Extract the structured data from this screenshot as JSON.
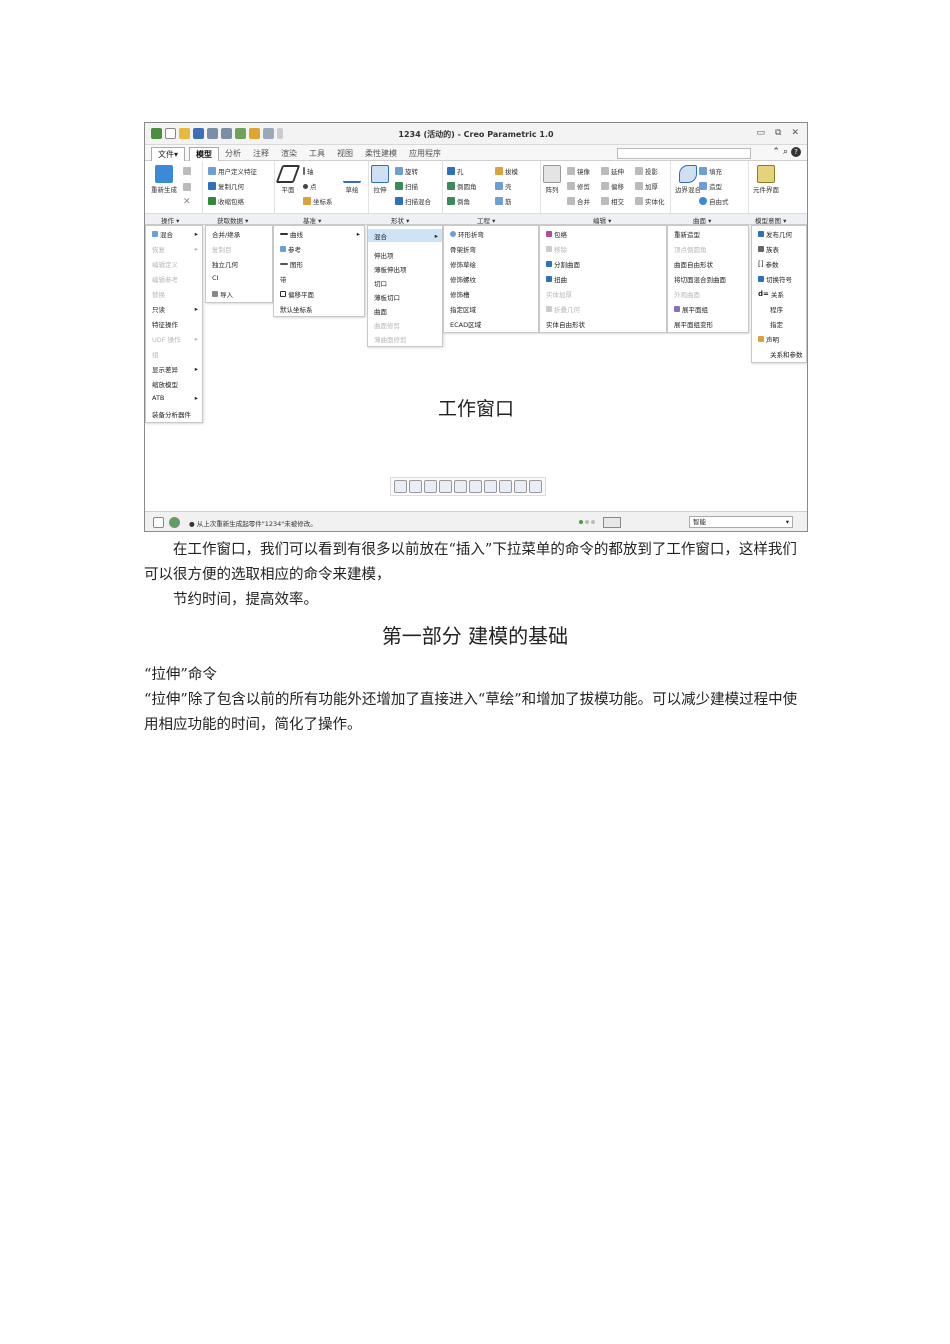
{
  "window": {
    "title": "1234 (活动的) - Creo Parametric 1.0",
    "tabs": {
      "file": "文件▾",
      "items": [
        "模型",
        "分析",
        "注释",
        "渲染",
        "工具",
        "视图",
        "柔性建模",
        "应用程序"
      ]
    },
    "ribbon": {
      "op": {
        "regen": "重新生成",
        "title": "操作 ▾"
      },
      "getdata": {
        "udf": "用户定义特征",
        "copygeom": "复制几何",
        "shrink": "收缩包络",
        "title": "获取数据 ▾"
      },
      "datum": {
        "plane": "平面",
        "axis": "轴",
        "point": "点",
        "csys": "坐标系",
        "curve": "草绘",
        "title": "基准 ▾"
      },
      "shapes": {
        "extrude": "拉伸",
        "revolve": "旋转",
        "sweep": "扫描",
        "sweptblend": "扫描混合",
        "title": "形状 ▾"
      },
      "eng": {
        "hole": "孔",
        "round": "倒圆角",
        "chamfer": "倒角",
        "draft": "拔模",
        "shell": "壳",
        "rib": "筋",
        "title": "工程 ▾"
      },
      "edit": {
        "pattern": "阵列",
        "mirror": "镜像",
        "extend": "延伸",
        "project": "投影",
        "trim": "修剪",
        "offset": "偏移",
        "thicken": "加厚",
        "merge": "合并",
        "intersect": "相交",
        "solidify": "实体化",
        "title": "编辑 ▾"
      },
      "surface": {
        "boundary": "边界混合",
        "fill": "填充",
        "style": "造型",
        "freestyle": "自由式",
        "title": "曲面 ▾"
      },
      "modelintent": {
        "component": "元件界面",
        "title": "模型意图 ▾"
      }
    },
    "menus": {
      "op": [
        "混合",
        "恢复",
        "编辑定义",
        "编辑参考",
        "替换",
        "只读",
        "特征操作",
        "UDF 操作",
        "组",
        "显示差异",
        "缩放模型",
        "ATB",
        "装备分析器件"
      ],
      "getdata": [
        "合并/继承",
        "复制目",
        "独立几何",
        "CI",
        "导入"
      ],
      "datum": [
        "曲线",
        "参考",
        "图形",
        "带",
        "偏移平面",
        "默认坐标系"
      ],
      "shapes_hl": "混合",
      "shapes": [
        "伸出项",
        "薄板伸出项",
        "切口",
        "薄板切口",
        "曲面",
        "曲面修剪",
        "薄曲面修剪"
      ],
      "eng": [
        "环形折弯",
        "骨架折弯",
        "修饰草绘",
        "修饰螺纹",
        "修饰槽",
        "指定区域",
        "ECAD区域"
      ],
      "edit": [
        "包络",
        "移除",
        "分割曲面",
        "扭曲",
        "实体加厚",
        "折叠几何",
        "实体自由形状"
      ],
      "surface": [
        "重新造型",
        "顶点倒圆角",
        "曲面自由形状",
        "将切面混合到曲面",
        "外观曲面",
        "展平面组",
        "展平面组变形"
      ],
      "modelintent": [
        "发布几何",
        "族表",
        "参数",
        "切换符号",
        "关系",
        "程序",
        "指定",
        "声明",
        "关系和参数"
      ]
    },
    "workarea": "工作窗口",
    "status": {
      "message": "● 从上次重新生成起零件\"1234\"未被修改。",
      "filter": "智能"
    },
    "colors": {
      "accent": "#2f6fbf",
      "highlight": "#cfe3f7"
    }
  },
  "body": {
    "para1": "在工作窗口，我们可以看到有很多以前放在“插入”下拉菜单的命令的都放到了工作窗口，这样我们可以很方便的选取相应的命令来建模，",
    "para2": "节约时间，提高效率。",
    "heading": "第一部分  建模的基础",
    "subhead": "“拉伸”命令",
    "para3": "“拉伸”除了包含以前的所有功能外还增加了直接进入“草绘”和增加了拔模功能。可以减少建模过程中使用相应功能的时间，简化了操作。"
  }
}
